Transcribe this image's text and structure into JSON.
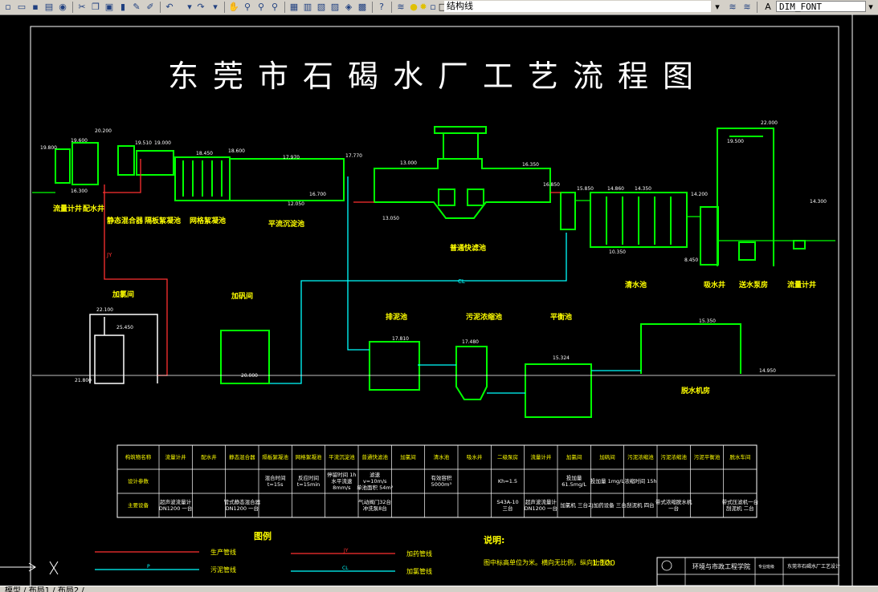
{
  "toolbar": {
    "layer_checkbox_label": "结构线",
    "dimstyle_value": "DIM_FONT"
  },
  "status": {
    "layout_tabs": "模型 / 布局1 / 布局2 /"
  },
  "drawing": {
    "title": "东莞市石碣水厂工艺流程图",
    "units_left": [
      {
        "label": "流量计井"
      },
      {
        "label": "配水井"
      },
      {
        "label": "静态混合器"
      },
      {
        "label": "隔板絮凝池"
      },
      {
        "label": "网格絮凝池"
      },
      {
        "label": "平流沉淀池"
      }
    ],
    "units_right": [
      {
        "label": "普通快滤池"
      },
      {
        "label": "清水池"
      },
      {
        "label": "吸水井"
      },
      {
        "label": "送水泵房"
      },
      {
        "label": "流量计井"
      }
    ],
    "units_bottom": [
      {
        "label": "加氯间"
      },
      {
        "label": "加矾间"
      },
      {
        "label": "排泥池"
      },
      {
        "label": "污泥浓缩池"
      },
      {
        "label": "平衡池"
      },
      {
        "label": "脱水机房"
      }
    ],
    "elevations": {
      "e1": "19.800",
      "e2": "19.600",
      "e3": "20.200",
      "e4": "16.300",
      "e5": "19.510",
      "e6": "19.000",
      "e7": "18.450",
      "e8": "18.600",
      "e9": "17.770",
      "e10": "17.970",
      "e11": "16.700",
      "e12": "12.050",
      "e13": "13.050",
      "e14": "13.000",
      "e15": "16.350",
      "e16": "16.850",
      "e17": "15.850",
      "e18": "14.860",
      "e19": "14.350",
      "e20": "14.200",
      "e21": "14.300",
      "e22": "22.000",
      "e23": "19.500",
      "e24": "10.350",
      "e25": "8.450",
      "e26": "22.100",
      "e27": "25.450",
      "e28": "21.800",
      "e29": "20.000",
      "e30": "17.810",
      "e31": "17.480",
      "e32": "15.324",
      "e33": "15.350",
      "e34": "14.950"
    },
    "pipe_labels": {
      "jy": "JY",
      "cl": "CL",
      "pipe_generic": "P"
    },
    "table": {
      "headers": [
        "构筑物名称",
        "流量计井",
        "配水井",
        "静态混合器",
        "隔板絮凝池",
        "网格絮凝池",
        "平流沉淀池",
        "普通快滤池",
        "加氯间",
        "清水池",
        "吸水井",
        "二级泵房",
        "流量计井",
        "加氯间",
        "加矾间",
        "污泥浓缩池",
        "污泥浓缩池",
        "污泥平衡池",
        "脱水车间"
      ],
      "row_labels": [
        "设计参数",
        "主要设备"
      ],
      "param_cells": [
        "",
        "",
        "",
        "混合时间 t=15s",
        "反应时间 t=15min",
        "停留时间 1h 水平流速 8mm/s",
        "滤速 v=10m/s 单池面积 54m²",
        "",
        "有效容积 5000m³",
        "",
        "Kh=1.5",
        "",
        "投加量 61.5mg/L",
        "投加量 1mg/L",
        "浓缩时间 15h",
        "",
        "",
        ""
      ],
      "equip_cells": [
        "超声波流量计 DN1200 一台",
        "",
        "管式静态混合器 DN1200 一台",
        "",
        "",
        "",
        "气动阀门32台 冲洗泵8台",
        "",
        "",
        "",
        "S43A-10 三台",
        "超声波流量计 DN1200 一台",
        "加氯机 三台",
        "ZJ加药设备 三台",
        "刮泥机 四台",
        "带式浓缩脱水机 一台",
        "",
        "带式压滤机一台 刮泥机 二台"
      ]
    },
    "legend": {
      "title": "图例",
      "items": [
        {
          "label": "生产管线",
          "code": ""
        },
        {
          "label": "加药管线",
          "code": "JY"
        },
        {
          "label": "污泥管线",
          "code": "P"
        },
        {
          "label": "加氯管线",
          "code": "CL"
        }
      ]
    },
    "notes": {
      "title": "说明:",
      "text": "图中标高单位为米。横向无比例，纵向比例为",
      "scale": "1:100"
    },
    "title_block": {
      "institute": "环境与市政工程学院",
      "drawing_name": "东莞市石碣水厂工艺设计",
      "field": "专业班级"
    }
  },
  "colors": {
    "structure": "#00ff00",
    "process_pipe": "#ff3030",
    "chlorine_pipe": "#00ffff",
    "text_label": "#ffff00",
    "frame": "#ffffff",
    "background": "#000000"
  }
}
